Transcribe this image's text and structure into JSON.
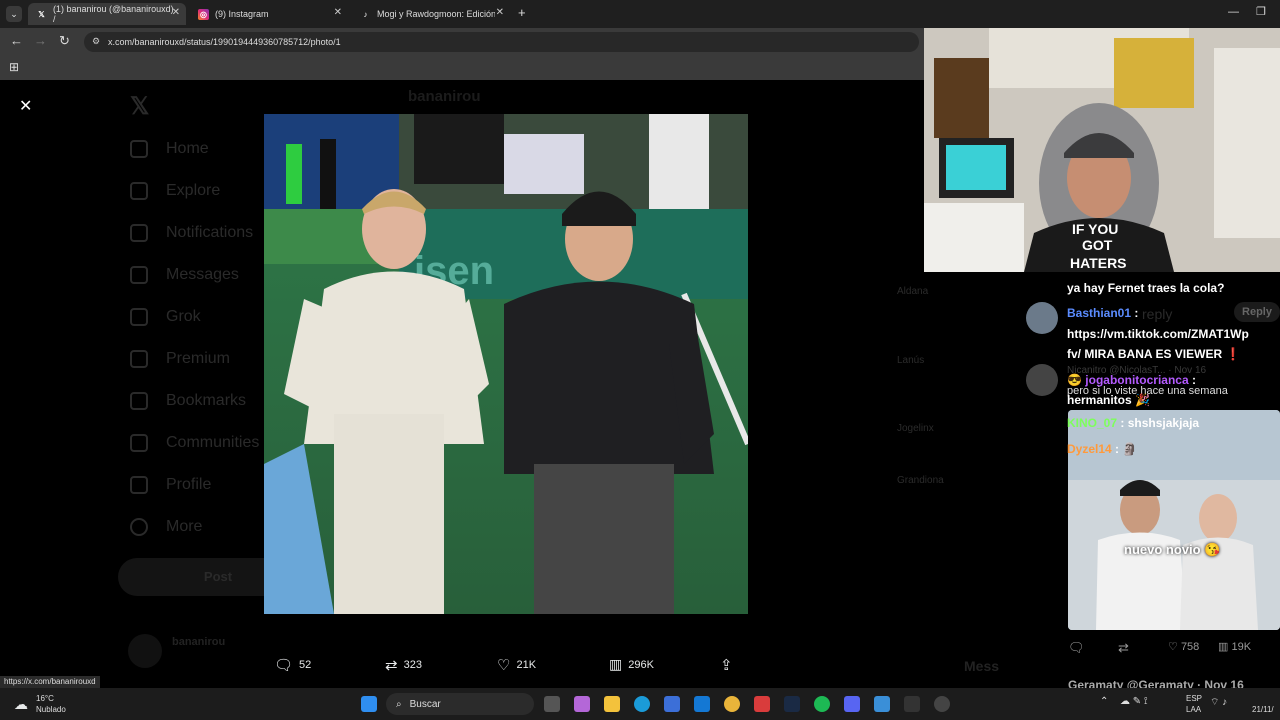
{
  "browser": {
    "tabs": [
      {
        "title": "(1) bananirou (@bananirouxd) /",
        "icon": "x-logo-icon"
      },
      {
        "title": "(9) Instagram",
        "icon": "instagram-icon"
      },
      {
        "title": "Mogi y Rawdogmoon: Edición d",
        "icon": "tiktok-icon"
      }
    ],
    "url": "x.com/bananirouxd/status/1990194449360785712/photo/1",
    "status_url": "https://x.com/bananirouxd"
  },
  "x_page": {
    "nav": [
      "Home",
      "Explore",
      "Notifications",
      "Messages",
      "Grok",
      "Premium",
      "Bookmarks",
      "Communities",
      "Profile",
      "More"
    ],
    "post_button": "Post",
    "header_name": "bananirou",
    "right_items": [
      "Aldana",
      "Lanús",
      "Jogelinx",
      "Grandiona"
    ],
    "bottom_name": "bananirou",
    "messages_label": "Mess"
  },
  "viewer": {
    "close_label": "✕",
    "replies": "52",
    "reposts": "323",
    "likes": "21K",
    "views": "296K"
  },
  "chat": {
    "messages": [
      {
        "user": "",
        "text": "ya hay Fernet traes la cola?",
        "user_color": "#ffffff"
      },
      {
        "user": "Basthian01",
        "text": ":",
        "user_color": "#5b8cff"
      },
      {
        "user": "",
        "text": "https://vm.tiktok.com/ZMAT1Wp",
        "user_color": "#ffffff"
      },
      {
        "user": "",
        "text": "fv/ MIRA BANA ES VIEWER ❗",
        "user_color": "#ffffff"
      },
      {
        "user": "jogabonitocrianca",
        "text": ":",
        "user_color": "#b45bff"
      },
      {
        "user": "",
        "text": "pero si lo viste hace una semana",
        "user_color": "#ffffff"
      },
      {
        "user": "",
        "text": "hermanitos 🎉",
        "user_color": "#ffffff"
      },
      {
        "user": "KINO_07",
        "text": ": shshsjakjaja",
        "user_color": "#7dff5b"
      },
      {
        "user": "Dyzel14",
        "text": ":",
        "user_color": "#ff9a3c"
      }
    ],
    "reply_label": "Reply",
    "reply_ghost": "reply",
    "ghost_user": "Nicanitro @NicolasT... · Nov 16",
    "image_caption": "nuevo novio 😘",
    "footer_stats": {
      "likes": "758",
      "views": "19K"
    },
    "bottom_user": "Geramaty @Geramaty · Nov 16"
  },
  "cam": {
    "shirt_text_1": "IF YOU",
    "shirt_text_2": "GOT",
    "shirt_text_3": "HATERS"
  },
  "taskbar": {
    "weather_temp": "16°C",
    "weather_desc": "Nublado",
    "search_placeholder": "Buscar",
    "lang_1": "ESP",
    "lang_2": "LAA",
    "date": "21/11/"
  }
}
